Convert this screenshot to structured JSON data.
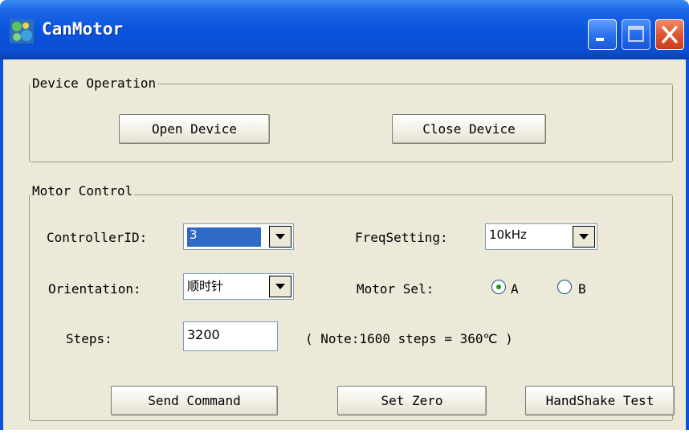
{
  "window": {
    "title": "CanMotor",
    "icon": "app-icon",
    "buttons": [
      "minimize-icon",
      "maximize-icon",
      "close-icon"
    ]
  },
  "device_operation": {
    "legend": "Device Operation",
    "open_label": "Open Device",
    "close_label": "Close Device"
  },
  "motor_control": {
    "legend": "Motor Control",
    "controller_id_label": "ControllerID:",
    "controller_id_value": "3",
    "freq_label": "FreqSetting:",
    "freq_value": "10kHz",
    "orientation_label": "Orientation:",
    "orientation_value": "顺时针",
    "motor_sel_label": "Motor Sel:",
    "motor_a": "A",
    "motor_b": "B",
    "motor_selected": "A",
    "steps_label": "Steps:",
    "steps_value": "3200",
    "note": "( Note:1600 steps = 360℃ )",
    "send_label": "Send Command",
    "zero_label": "Set Zero",
    "handshake_label": "HandShake Test"
  },
  "colors": {
    "titlebar": "#0a54dd",
    "face": "#ece9d8",
    "selection": "#316ac5",
    "radio_dot": "#1a9c1a"
  }
}
